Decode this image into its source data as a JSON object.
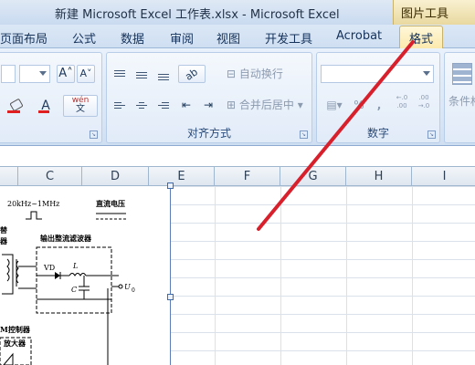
{
  "window": {
    "title": "新建 Microsoft Excel 工作表.xlsx - Microsoft Excel",
    "context_tab_group": "图片工具"
  },
  "tabs": [
    "页面布局",
    "公式",
    "数据",
    "审阅",
    "视图",
    "开发工具",
    "Acrobat",
    "格式"
  ],
  "active_tab": "格式",
  "ribbon": {
    "font_group": {
      "grow_font": "A˄",
      "shrink_font": "A˅",
      "font_color": "A",
      "phonetic": "wén",
      "phonetic_sub": "文"
    },
    "alignment_group": {
      "label": "对齐方式",
      "wrap_text": "自动换行",
      "merge_center": "合并后居中"
    },
    "number_group": {
      "label": "数字",
      "percent": "%",
      "comma": ",",
      "inc_decimal": "←.0 .00",
      "dec_decimal": ".00 →.0"
    },
    "styles_group": {
      "conditional_format": "条件格"
    }
  },
  "columns": [
    "C",
    "D",
    "E",
    "F",
    "G",
    "H",
    "I"
  ],
  "picture": {
    "freq_label": "20kHz~1MHz",
    "dc_label": "直流电压",
    "filter_label": "输出整流滤波器",
    "pwm_label": "M控制器",
    "amp_label": "放大器",
    "vd_label": "VD",
    "l_label": "L",
    "c_label": "C",
    "uo_label": "U",
    "side_label_1": "替",
    "side_label_2": "器"
  },
  "colors": {
    "annotation_line": "#d8202c",
    "ribbon_bg": "#dbe7f5",
    "context_tab": "#fbe9ad"
  }
}
